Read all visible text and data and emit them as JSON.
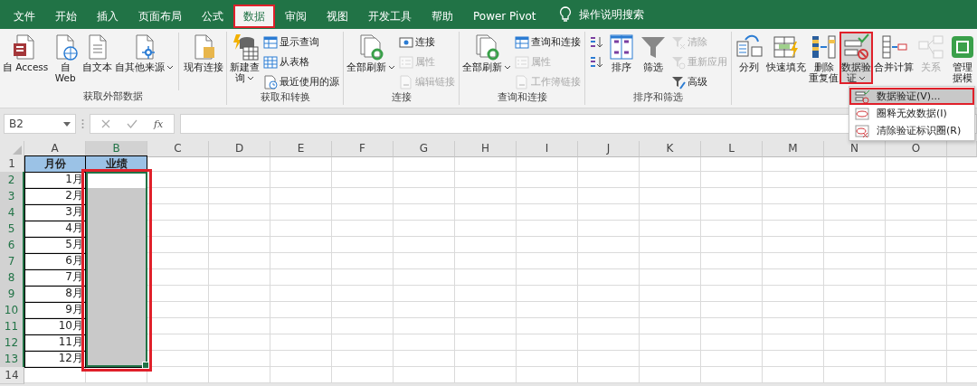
{
  "tabs": [
    {
      "label": "文件",
      "selected": false
    },
    {
      "label": "开始",
      "selected": false
    },
    {
      "label": "插入",
      "selected": false
    },
    {
      "label": "页面布局",
      "selected": false
    },
    {
      "label": "公式",
      "selected": false
    },
    {
      "label": "数据",
      "selected": true,
      "highlighted": true
    },
    {
      "label": "审阅",
      "selected": false
    },
    {
      "label": "视图",
      "selected": false
    },
    {
      "label": "开发工具",
      "selected": false
    },
    {
      "label": "帮助",
      "selected": false
    },
    {
      "label": "Power Pivot",
      "selected": false
    }
  ],
  "tell_me": {
    "label": "操作说明搜索"
  },
  "ribbon_groups": [
    {
      "label": "获取外部数据",
      "items": [
        {
          "kind": "large",
          "lines": [
            "自 Access"
          ]
        },
        {
          "kind": "large",
          "lines": [
            "自",
            "Web"
          ]
        },
        {
          "kind": "large",
          "lines": [
            "自文本"
          ]
        },
        {
          "kind": "large",
          "lines": [
            "自其他来源"
          ],
          "dropdown": true
        },
        {
          "kind": "separator"
        },
        {
          "kind": "large",
          "lines": [
            "现有连接"
          ]
        }
      ]
    },
    {
      "label": "获取和转换",
      "items": [
        {
          "kind": "large",
          "lines": [
            "新建查",
            "询"
          ],
          "dropdown": true
        },
        {
          "kind": "stack",
          "items": [
            {
              "label": "显示查询",
              "disabled": false
            },
            {
              "label": "从表格",
              "disabled": false
            },
            {
              "label": "最近使用的源",
              "disabled": false
            }
          ]
        }
      ]
    },
    {
      "label": "连接",
      "items": [
        {
          "kind": "large",
          "lines": [
            "全部刷新"
          ],
          "dropdown": true
        },
        {
          "kind": "stack",
          "items": [
            {
              "label": "连接",
              "disabled": false
            },
            {
              "label": "属性",
              "disabled": true
            },
            {
              "label": "编辑链接",
              "disabled": true
            }
          ]
        }
      ]
    },
    {
      "label": "查询和连接",
      "items": [
        {
          "kind": "large",
          "lines": [
            "全部刷新"
          ],
          "dropdown": true
        },
        {
          "kind": "stack",
          "items": [
            {
              "label": "查询和连接",
              "disabled": false
            },
            {
              "label": "属性",
              "disabled": true
            },
            {
              "label": "工作簿链接",
              "disabled": true
            }
          ]
        }
      ]
    },
    {
      "label": "排序和筛选",
      "items": [
        {
          "kind": "stack",
          "items": [
            {
              "disabled": false
            },
            {
              "disabled": false
            }
          ]
        },
        {
          "kind": "large",
          "lines": [
            "排序"
          ]
        },
        {
          "kind": "large",
          "lines": [
            "筛选"
          ]
        },
        {
          "kind": "stack",
          "items": [
            {
              "label": "清除",
              "disabled": true
            },
            {
              "label": "重新应用",
              "disabled": true
            },
            {
              "label": "高级",
              "disabled": false
            }
          ]
        }
      ]
    },
    {
      "items": [
        {
          "kind": "large",
          "lines": [
            "分列"
          ]
        },
        {
          "kind": "large",
          "lines": [
            "快速填充"
          ]
        },
        {
          "kind": "large",
          "lines": [
            "删除",
            "重复值"
          ]
        },
        {
          "kind": "large",
          "lines": [
            "数据验",
            "证"
          ],
          "dropdown": true,
          "highlighted": true
        },
        {
          "kind": "large",
          "lines": [
            "合并计算"
          ]
        },
        {
          "kind": "large",
          "lines": [
            "关系"
          ],
          "disabled": true
        },
        {
          "kind": "large",
          "lines": [
            "管理",
            "据模"
          ]
        }
      ]
    }
  ],
  "menu": {
    "items": [
      {
        "label": "数据验证(V)...",
        "selected": true
      },
      {
        "label": "圈释无效数据(I)",
        "selected": false
      },
      {
        "label": "清除验证标识圈(R)",
        "selected": false
      }
    ]
  },
  "name_box": "B2",
  "function_button": "fx",
  "columns": [
    {
      "label": "A",
      "selected": false
    },
    {
      "label": "B",
      "selected": true
    },
    {
      "label": "C",
      "selected": false
    },
    {
      "label": "D",
      "selected": false
    },
    {
      "label": "E",
      "selected": false
    },
    {
      "label": "F",
      "selected": false
    },
    {
      "label": "G",
      "selected": false
    },
    {
      "label": "H",
      "selected": false
    },
    {
      "label": "I",
      "selected": false
    },
    {
      "label": "J",
      "selected": false
    },
    {
      "label": "K",
      "selected": false
    },
    {
      "label": "L",
      "selected": false
    },
    {
      "label": "M",
      "selected": false
    },
    {
      "label": "N",
      "selected": false
    },
    {
      "label": "O",
      "selected": false
    }
  ],
  "rows": [
    {
      "number": "1",
      "selected": false,
      "cells": [
        {
          "kind": "header",
          "value": "月份"
        },
        {
          "kind": "header",
          "value": "业绩"
        }
      ]
    },
    {
      "number": "2",
      "selected": true,
      "cells": [
        {
          "kind": "month",
          "value": "1月"
        },
        {
          "kind": "active"
        }
      ]
    },
    {
      "number": "3",
      "selected": true,
      "cells": [
        {
          "kind": "month",
          "value": "2月"
        },
        {
          "kind": "shaded"
        }
      ]
    },
    {
      "number": "4",
      "selected": true,
      "cells": [
        {
          "kind": "month",
          "value": "3月"
        },
        {
          "kind": "shaded"
        }
      ]
    },
    {
      "number": "5",
      "selected": true,
      "cells": [
        {
          "kind": "month",
          "value": "4月"
        },
        {
          "kind": "shaded"
        }
      ]
    },
    {
      "number": "6",
      "selected": true,
      "cells": [
        {
          "kind": "month",
          "value": "5月"
        },
        {
          "kind": "shaded"
        }
      ]
    },
    {
      "number": "7",
      "selected": true,
      "cells": [
        {
          "kind": "month",
          "value": "6月"
        },
        {
          "kind": "shaded"
        }
      ]
    },
    {
      "number": "8",
      "selected": true,
      "cells": [
        {
          "kind": "month",
          "value": "7月"
        },
        {
          "kind": "shaded"
        }
      ]
    },
    {
      "number": "9",
      "selected": true,
      "cells": [
        {
          "kind": "month",
          "value": "8月"
        },
        {
          "kind": "shaded"
        }
      ]
    },
    {
      "number": "10",
      "selected": true,
      "cells": [
        {
          "kind": "month",
          "value": "9月"
        },
        {
          "kind": "shaded"
        }
      ]
    },
    {
      "number": "11",
      "selected": true,
      "cells": [
        {
          "kind": "month",
          "value": "10月"
        },
        {
          "kind": "shaded"
        }
      ]
    },
    {
      "number": "12",
      "selected": true,
      "cells": [
        {
          "kind": "month",
          "value": "11月"
        },
        {
          "kind": "shaded"
        }
      ]
    },
    {
      "number": "13",
      "selected": true,
      "cells": [
        {
          "kind": "month",
          "value": "12月"
        },
        {
          "kind": "shaded"
        }
      ]
    },
    {
      "number": "14",
      "selected": false,
      "cells": []
    }
  ],
  "range_highlighted": true
}
